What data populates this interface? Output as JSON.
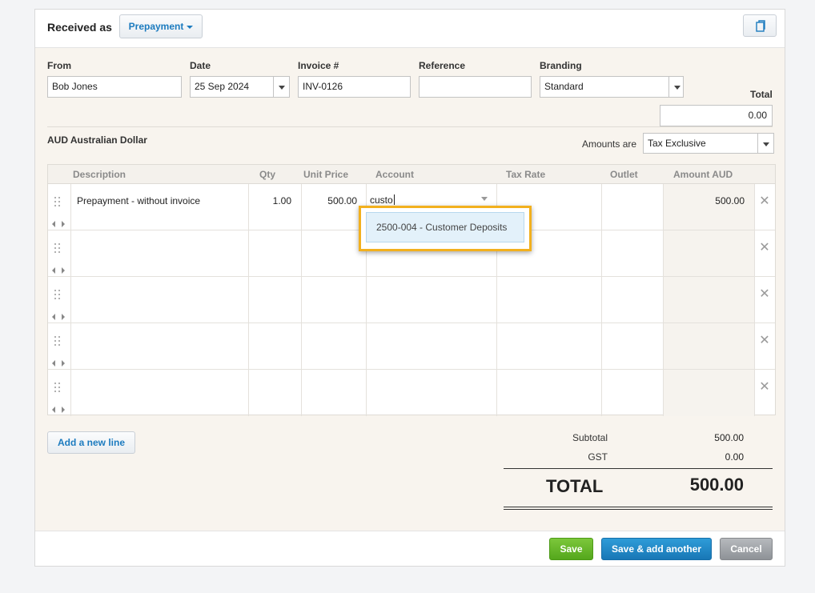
{
  "header": {
    "received_as_label": "Received as",
    "type_button_label": "Prepayment",
    "copy_icon": "copy-icon"
  },
  "form": {
    "from": {
      "label": "From",
      "value": "Bob Jones"
    },
    "date": {
      "label": "Date",
      "value": "25 Sep 2024"
    },
    "invoice_number": {
      "label": "Invoice #",
      "value": "INV-0126"
    },
    "reference": {
      "label": "Reference",
      "value": ""
    },
    "branding": {
      "label": "Branding",
      "value": "Standard"
    },
    "total": {
      "label": "Total",
      "value": "0.00"
    }
  },
  "currency_label": "AUD Australian Dollar",
  "amounts_are": {
    "label": "Amounts are",
    "value": "Tax Exclusive"
  },
  "table": {
    "columns": [
      "Description",
      "Qty",
      "Unit Price",
      "Account",
      "Tax Rate",
      "Outlet",
      "Amount AUD"
    ],
    "rows": [
      {
        "description": "Prepayment - without invoice",
        "qty": "1.00",
        "unit_price": "500.00",
        "account": "custo",
        "tax_rate": "",
        "outlet": "",
        "amount": "500.00"
      },
      {
        "description": "",
        "qty": "",
        "unit_price": "",
        "account": "",
        "tax_rate": "",
        "outlet": "",
        "amount": ""
      },
      {
        "description": "",
        "qty": "",
        "unit_price": "",
        "account": "",
        "tax_rate": "",
        "outlet": "",
        "amount": ""
      },
      {
        "description": "",
        "qty": "",
        "unit_price": "",
        "account": "",
        "tax_rate": "",
        "outlet": "",
        "amount": ""
      },
      {
        "description": "",
        "qty": "",
        "unit_price": "",
        "account": "",
        "tax_rate": "",
        "outlet": "",
        "amount": ""
      }
    ],
    "delete_symbol": "✕"
  },
  "account_suggestion": "2500-004 - Customer Deposits",
  "add_line_label": "Add a new line",
  "totals": {
    "subtotal_label": "Subtotal",
    "subtotal_value": "500.00",
    "gst_label": "GST",
    "gst_value": "0.00",
    "total_label": "TOTAL",
    "total_value": "500.00"
  },
  "footer": {
    "save_label": "Save",
    "save_add_label": "Save & add another",
    "cancel_label": "Cancel"
  },
  "colors": {
    "accent_blue": "#1c7bbf",
    "save_green": "#54a71c",
    "highlight_yellow": "#f2b01e",
    "panel_bg": "#f8f4ee"
  }
}
